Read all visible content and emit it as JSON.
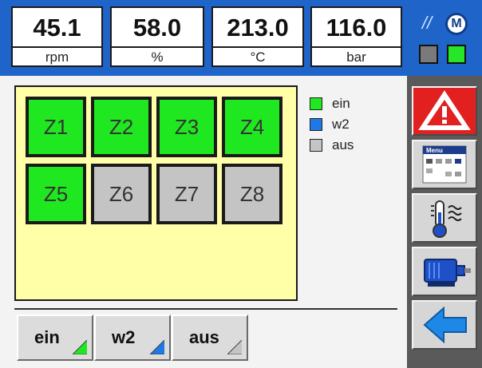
{
  "gauges": [
    {
      "value": "45.1",
      "unit": "rpm"
    },
    {
      "value": "58.0",
      "unit": "%"
    },
    {
      "value": "213.0",
      "unit": "°C"
    },
    {
      "value": "116.0",
      "unit": "bar"
    }
  ],
  "header": {
    "indicator_1_color": "#7a7a7a",
    "indicator_2_color": "#27e627",
    "motor_symbol": "M",
    "signal_glyph": "//"
  },
  "zones": [
    {
      "label": "Z1",
      "state": "ein"
    },
    {
      "label": "Z2",
      "state": "ein"
    },
    {
      "label": "Z3",
      "state": "ein"
    },
    {
      "label": "Z4",
      "state": "ein"
    },
    {
      "label": "Z5",
      "state": "ein"
    },
    {
      "label": "Z6",
      "state": "aus"
    },
    {
      "label": "Z7",
      "state": "aus"
    },
    {
      "label": "Z8",
      "state": "aus"
    }
  ],
  "legend": [
    {
      "label": "ein",
      "color": "#20e820"
    },
    {
      "label": "w2",
      "color": "#1e78e6"
    },
    {
      "label": "aus",
      "color": "#c4c4c4"
    }
  ],
  "buttons": [
    {
      "label": "ein",
      "corner_color": "#20e820"
    },
    {
      "label": "w2",
      "corner_color": "#1e78e6"
    },
    {
      "label": "aus",
      "corner_color": "#c4c4c4"
    }
  ],
  "sidebar": {
    "icons": [
      "warning-icon",
      "menu-icon",
      "temperature-icon",
      "motor-icon",
      "back-arrow-icon"
    ],
    "menu_icon_text": "Menu"
  },
  "colors": {
    "header_bg": "#1f64c8",
    "panel_bg": "#ffffa8",
    "zone_on": "#20e820",
    "zone_off": "#c4c4c4",
    "alarm_red": "#e22020"
  }
}
